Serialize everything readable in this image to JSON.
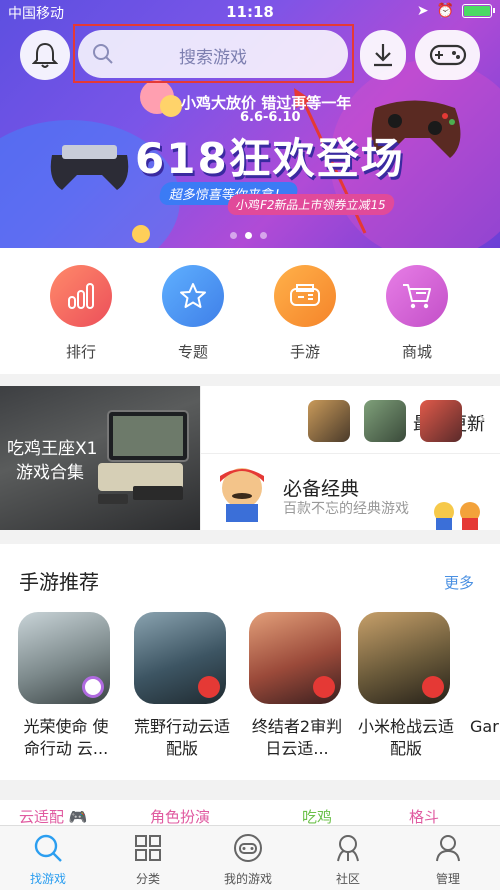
{
  "status_bar": {
    "carrier": "中国移动",
    "time": "11:18"
  },
  "header": {
    "search_placeholder": "搜索游戏"
  },
  "banner": {
    "promo_line": "小鸡大放价  错过再等一年",
    "date_range": "6.6-6.10",
    "title": "618狂欢登场",
    "tag1": "超多惊喜等你来拿！",
    "tag2": "小鸡F2新品上市领券立减15"
  },
  "categories": [
    {
      "label": "排行",
      "icon": "bar-chart-icon",
      "color": "#f26a55"
    },
    {
      "label": "专题",
      "icon": "star-icon",
      "color": "#4a8ff0"
    },
    {
      "label": "手游",
      "icon": "gamepad-icon",
      "color": "#fb9a2e"
    },
    {
      "label": "商城",
      "icon": "cart-icon",
      "color": "#d45fd0"
    }
  ],
  "feature": {
    "left_title": "吃鸡王座X1",
    "left_subtitle": "游戏合集",
    "recent_label": "最近更新",
    "must_title": "必备经典",
    "must_subtitle": "百款不忘的经典游戏"
  },
  "recommend": {
    "title": "手游推荐",
    "more_label": "更多",
    "games": [
      {
        "name": "光荣使命 使命行动 云..."
      },
      {
        "name": "荒野行动云适配版"
      },
      {
        "name": "终结者2审判日云适..."
      },
      {
        "name": "小米枪战云适配版"
      },
      {
        "name": "Gar"
      }
    ]
  },
  "tags": [
    {
      "label": "云适配",
      "color": "#e05aa0"
    },
    {
      "label": "角色扮演",
      "color": "#e05aa0"
    },
    {
      "label": "吃鸡",
      "color": "#6cc04a"
    },
    {
      "label": "格斗",
      "color": "#e05aa0"
    }
  ],
  "tabbar": {
    "active": "找游戏",
    "tabs": [
      {
        "label": "找游戏",
        "icon": "search-icon"
      },
      {
        "label": "分类",
        "icon": "grid-icon"
      },
      {
        "label": "我的游戏",
        "icon": "controller-icon"
      },
      {
        "label": "社区",
        "icon": "community-icon"
      },
      {
        "label": "管理",
        "icon": "manage-icon"
      }
    ]
  },
  "colors": {
    "accent": "#2b9ef0",
    "highlight_frame": "#e53935"
  }
}
